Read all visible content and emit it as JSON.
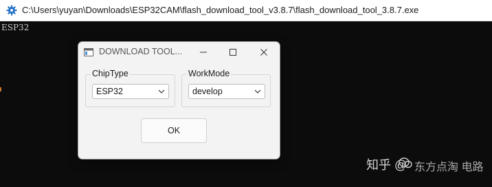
{
  "console": {
    "title": "C:\\Users\\yuyan\\Downloads\\ESP32CAM\\flash_download_tool_v3.8.7\\flash_download_tool_3.8.7.exe",
    "output_text": "ESP32",
    "icon": "gear-icon"
  },
  "dialog": {
    "title": "DOWNLOAD TOOL...",
    "chip_type": {
      "label": "ChipType",
      "value": "ESP32"
    },
    "work_mode": {
      "label": "WorkMode",
      "value": "develop"
    },
    "ok_label": "OK"
  },
  "watermark": {
    "text": "知乎 @",
    "logo_text": "东方点淘 电路"
  }
}
